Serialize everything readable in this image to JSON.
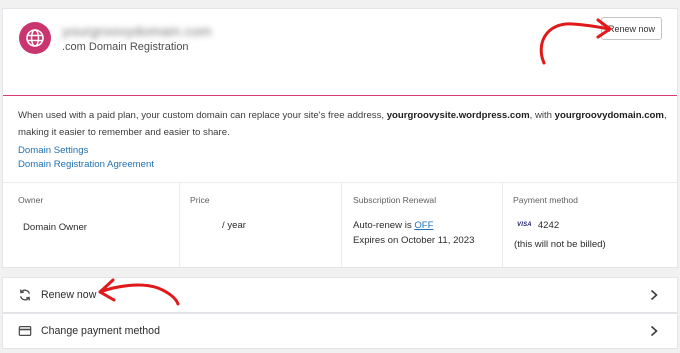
{
  "domain": {
    "name": "yourgroovydomain.com",
    "registration_label": ".com Domain Registration",
    "renew_button_label": "Renew now",
    "icon": "globe-icon"
  },
  "description": {
    "part1": "When used with a paid plan, your custom domain can replace your site's free address, ",
    "site_address": "yourgroovysite.wordpress.com",
    "part2": ", with ",
    "custom_domain": "yourgroovydomain.com",
    "part3": ", making it easier to remember and easier to share."
  },
  "links": {
    "settings": "Domain Settings",
    "agreement": "Domain Registration Agreement"
  },
  "details": {
    "owner": {
      "label": "Owner",
      "value": "Domain Owner"
    },
    "price": {
      "label": "Price",
      "value": "/ year"
    },
    "renewal": {
      "label": "Subscription Renewal",
      "auto_renew_prefix": "Auto-renew is ",
      "auto_renew_state": "OFF",
      "expires": "Expires on October 11, 2023"
    },
    "payment": {
      "label": "Payment method",
      "card_brand": "VISA",
      "card_last4": "4242",
      "note": "(this will not be billed)"
    }
  },
  "actions": {
    "renew": {
      "label": "Renew now",
      "icon": "sync-icon"
    },
    "change_payment": {
      "label": "Change payment method",
      "icon": "credit-card-icon"
    }
  },
  "colors": {
    "accent_pink": "#c9356e",
    "link_blue": "#2271b1",
    "annotation_red": "#e01a1a"
  }
}
